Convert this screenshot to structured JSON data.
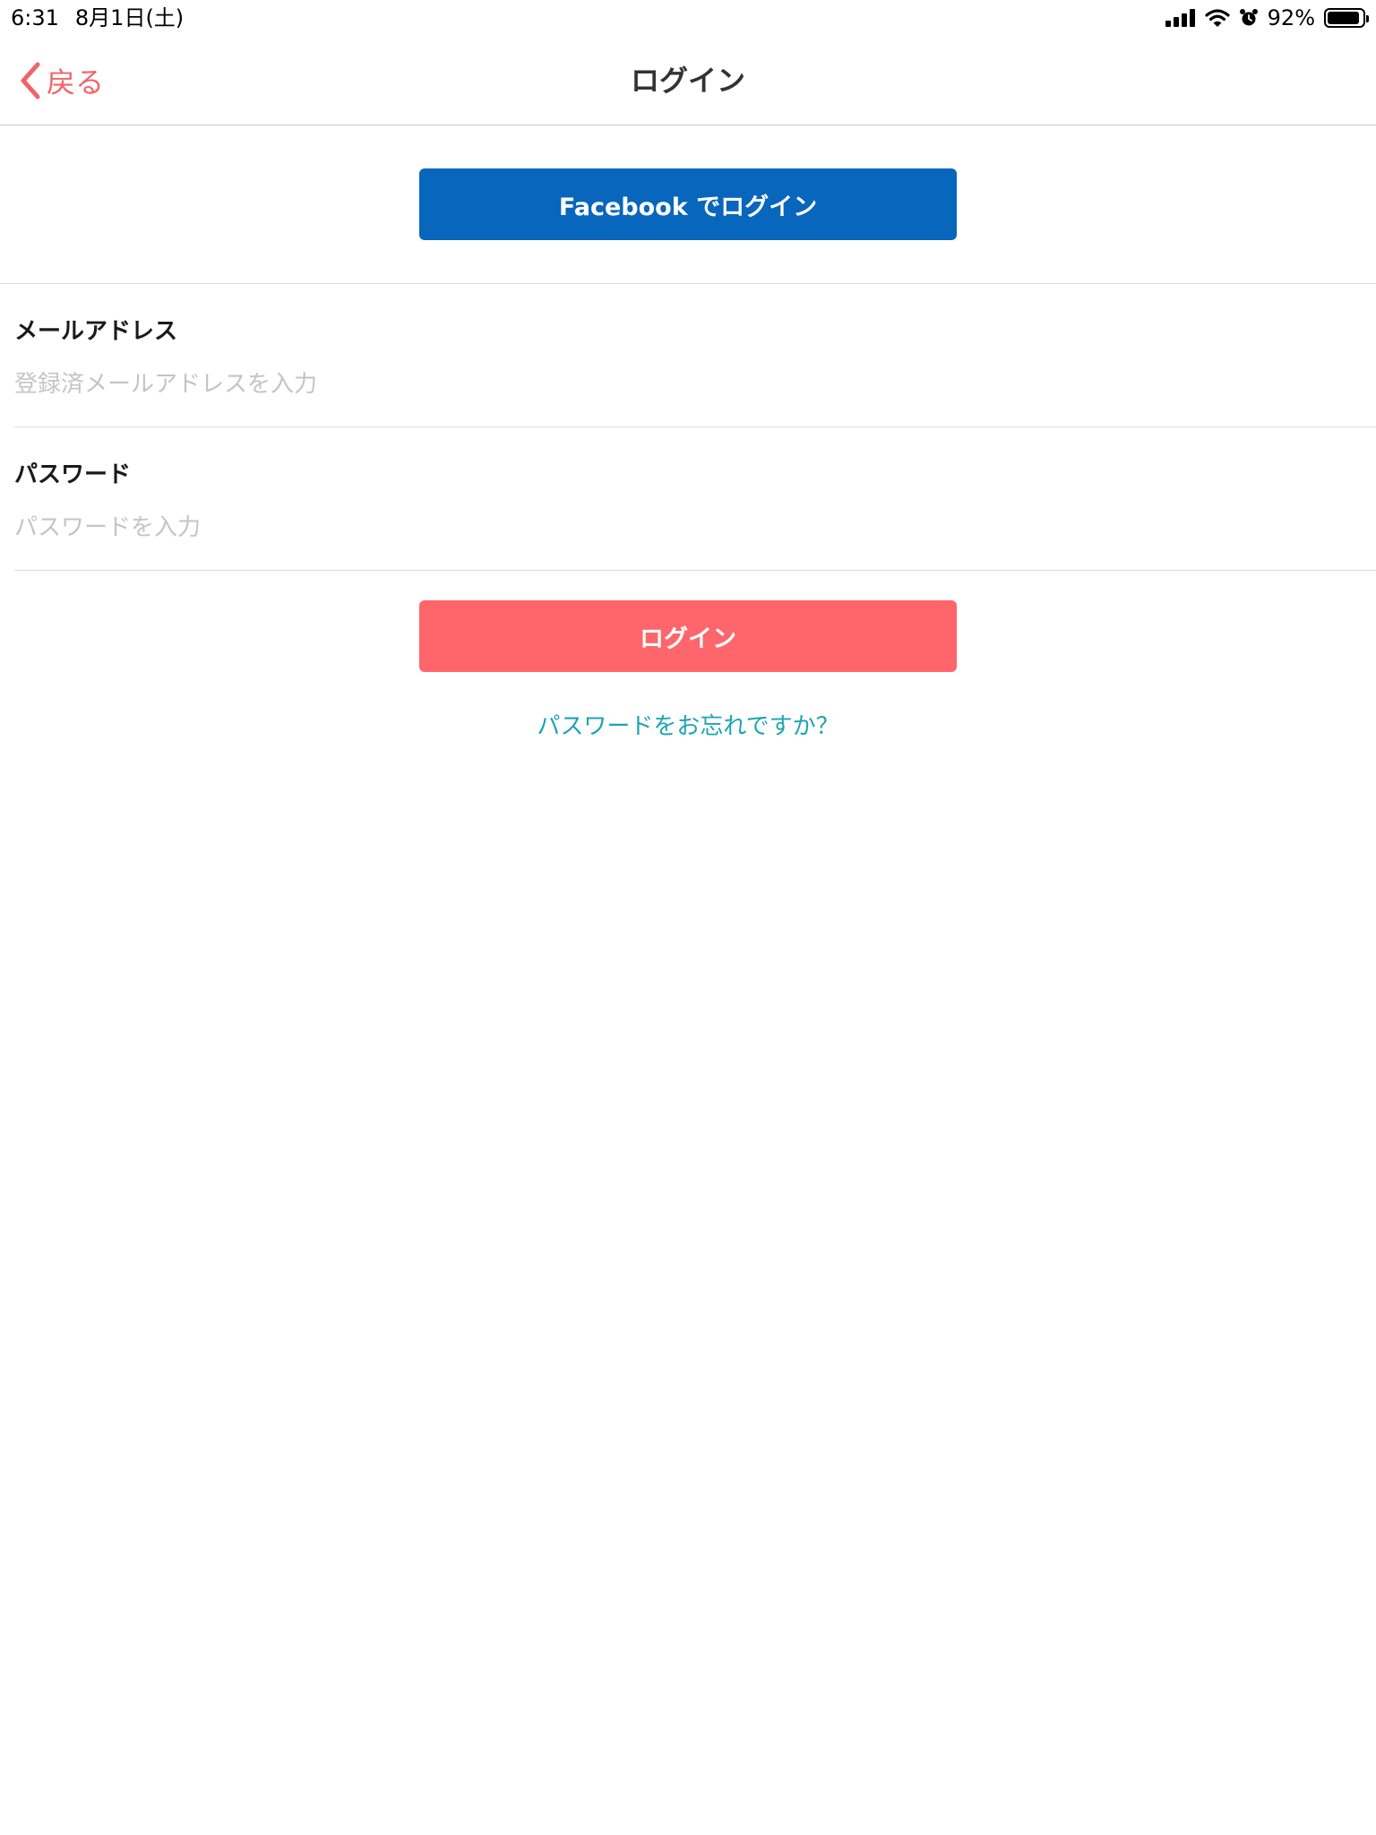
{
  "status_bar": {
    "time": "6:31",
    "date": "8月1日(土)",
    "battery_percent": "92%",
    "battery_level": 0.92,
    "icons": [
      "cellular-signal-icon",
      "wifi-icon",
      "alarm-icon",
      "battery-icon"
    ]
  },
  "nav": {
    "back_label": "戻る",
    "title": "ログイン",
    "back_icon": "chevron-left-icon"
  },
  "facebook_button": {
    "label": "Facebook でログイン"
  },
  "form": {
    "email": {
      "label": "メールアドレス",
      "value": "",
      "placeholder": "登録済メールアドレスを入力"
    },
    "password": {
      "label": "パスワード",
      "value": "",
      "placeholder": "パスワードを入力"
    }
  },
  "login_button": {
    "label": "ログイン"
  },
  "forgot_password": {
    "label": "パスワードをお忘れですか？"
  },
  "colors": {
    "accent": "#f0646a",
    "facebook_blue": "#0866bd",
    "login_button": "#fe666b",
    "link": "#1fa3b4"
  }
}
